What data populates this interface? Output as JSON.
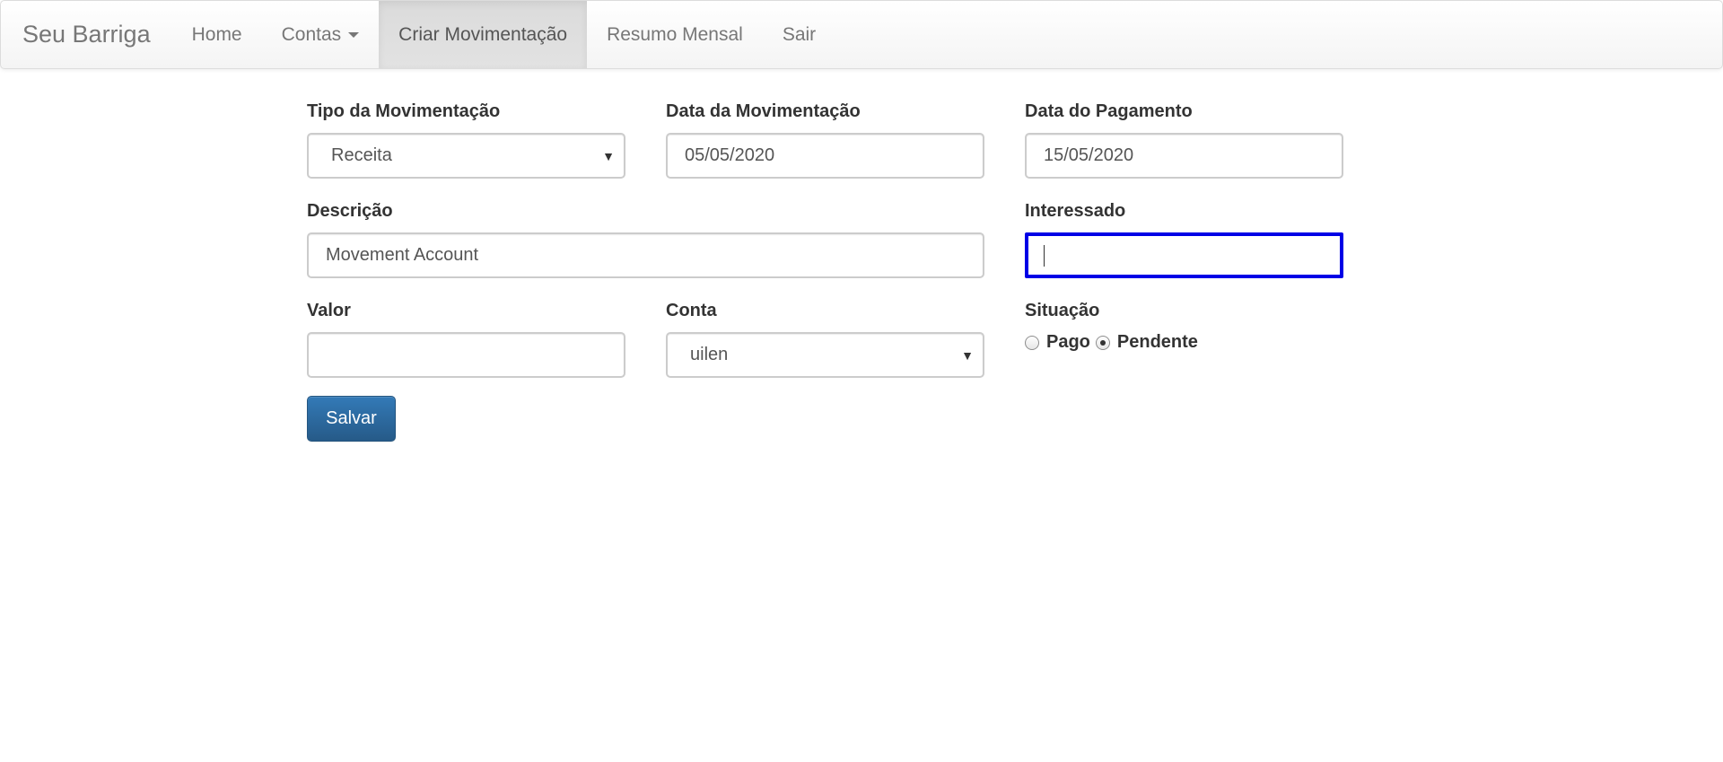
{
  "navbar": {
    "brand": "Seu Barriga",
    "items": [
      {
        "label": "Home"
      },
      {
        "label": "Contas"
      },
      {
        "label": "Criar Movimentação"
      },
      {
        "label": "Resumo Mensal"
      },
      {
        "label": "Sair"
      }
    ],
    "active_item": "Criar Movimentação"
  },
  "form": {
    "tipo": {
      "label": "Tipo da Movimentação",
      "value": "Receita"
    },
    "data_movimentacao": {
      "label": "Data da Movimentação",
      "value": "05/05/2020"
    },
    "data_pagamento": {
      "label": "Data do Pagamento",
      "value": "15/05/2020"
    },
    "descricao": {
      "label": "Descrição",
      "value": "Movement Account"
    },
    "interessado": {
      "label": "Interessado",
      "value": ""
    },
    "valor": {
      "label": "Valor",
      "value": ""
    },
    "conta": {
      "label": "Conta",
      "value": "uilen"
    },
    "situacao": {
      "label": "Situação",
      "options": [
        {
          "label": "Pago",
          "checked": false
        },
        {
          "label": "Pendente",
          "checked": true
        }
      ]
    },
    "submit_label": "Salvar"
  },
  "colors": {
    "focus_outline": "#0000e6",
    "primary_button": "#337ab7"
  }
}
